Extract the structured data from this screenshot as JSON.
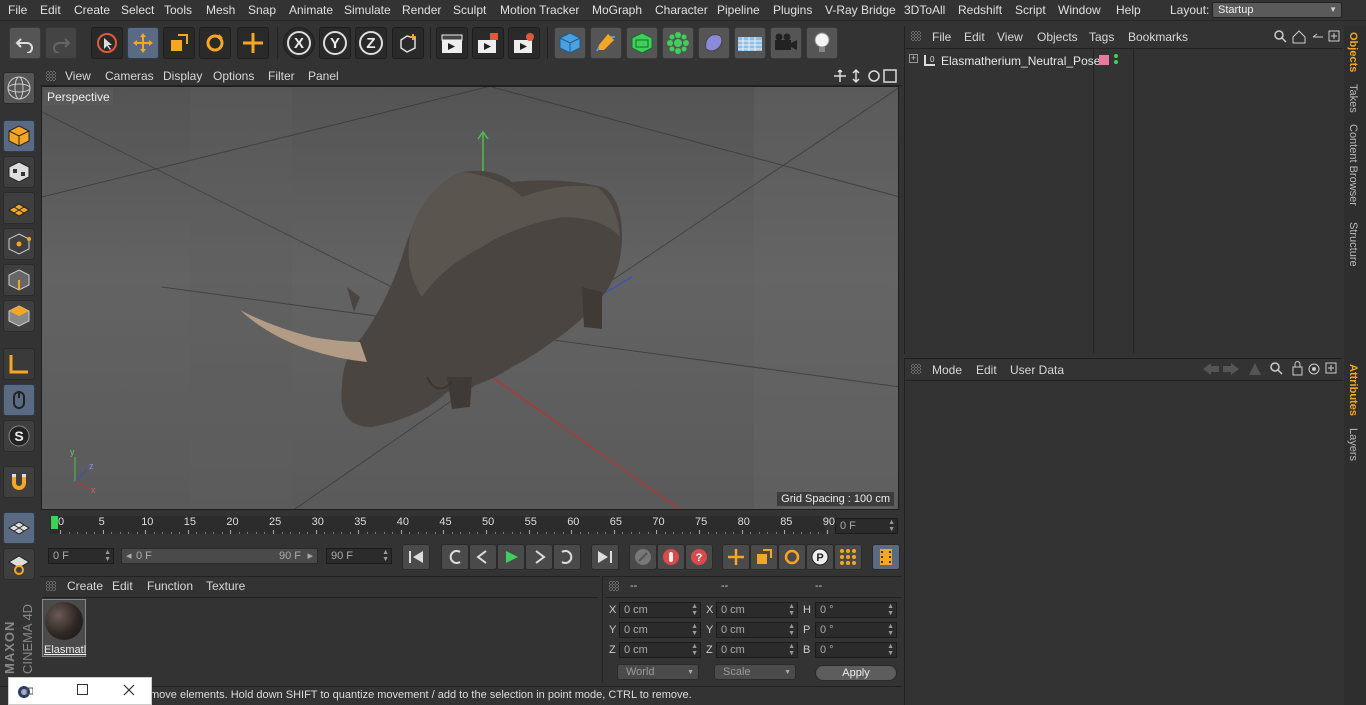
{
  "menu": [
    "File",
    "Edit",
    "Create",
    "Select",
    "Tools",
    "Mesh",
    "Snap",
    "Animate",
    "Simulate",
    "Render",
    "Sculpt",
    "Motion Tracker",
    "MoGraph",
    "Character",
    "Pipeline",
    "Plugins",
    "V-Ray Bridge",
    "3DToAll",
    "Redshift",
    "Script",
    "Window",
    "Help"
  ],
  "layout": {
    "label": "Layout:",
    "value": "Startup"
  },
  "axis_buttons": {
    "x": "X",
    "y": "Y",
    "z": "Z"
  },
  "viewport": {
    "menu": [
      "View",
      "Cameras",
      "Display",
      "Options",
      "Filter",
      "Panel"
    ],
    "label": "Perspective",
    "grid_spacing": "Grid Spacing : 100 cm",
    "axis_x": "x",
    "axis_y": "y",
    "axis_z": "z"
  },
  "timeline": {
    "ticks": [
      "0",
      "5",
      "10",
      "15",
      "20",
      "25",
      "30",
      "35",
      "40",
      "45",
      "50",
      "55",
      "60",
      "65",
      "70",
      "75",
      "80",
      "85",
      "90"
    ],
    "current_frame": "0 F"
  },
  "controls": {
    "start_field": "0 F",
    "range_start": "0 F",
    "range_end": "90 F",
    "end_field": "90 F"
  },
  "material_panel": {
    "menu": [
      "Create",
      "Edit",
      "Function",
      "Texture"
    ],
    "material_name": "Elasmatl"
  },
  "coords": {
    "headers": [
      "--",
      "--",
      "--"
    ],
    "rows": [
      {
        "a": "X",
        "av": "0 cm",
        "b": "X",
        "bv": "0 cm",
        "c": "H",
        "cv": "0 °"
      },
      {
        "a": "Y",
        "av": "0 cm",
        "b": "Y",
        "bv": "0 cm",
        "c": "P",
        "cv": "0 °"
      },
      {
        "a": "Z",
        "av": "0 cm",
        "b": "Z",
        "bv": "0 cm",
        "c": "B",
        "cv": "0 °"
      }
    ],
    "world": "World",
    "scale": "Scale",
    "apply": "Apply"
  },
  "status": "move elements. Hold down SHIFT to quantize movement / add to the selection in point mode, CTRL to remove.",
  "objects_panel": {
    "menu": [
      "File",
      "Edit",
      "View",
      "Objects",
      "Tags",
      "Bookmarks"
    ],
    "object_name": "Elasmatherium_Neutral_Pose"
  },
  "attributes_panel": {
    "menu": [
      "Mode",
      "Edit",
      "User Data"
    ]
  },
  "side_tabs": [
    "Objects",
    "Takes",
    "Content Browser",
    "Structure",
    "Attributes",
    "Layers"
  ],
  "brand": {
    "maxon": "MAXON",
    "product": "CINEMA 4D"
  },
  "colors": {
    "accent": "#f5a623",
    "selected": "#5a6a82",
    "green": "#3fd05a",
    "red": "#d94a4a"
  }
}
